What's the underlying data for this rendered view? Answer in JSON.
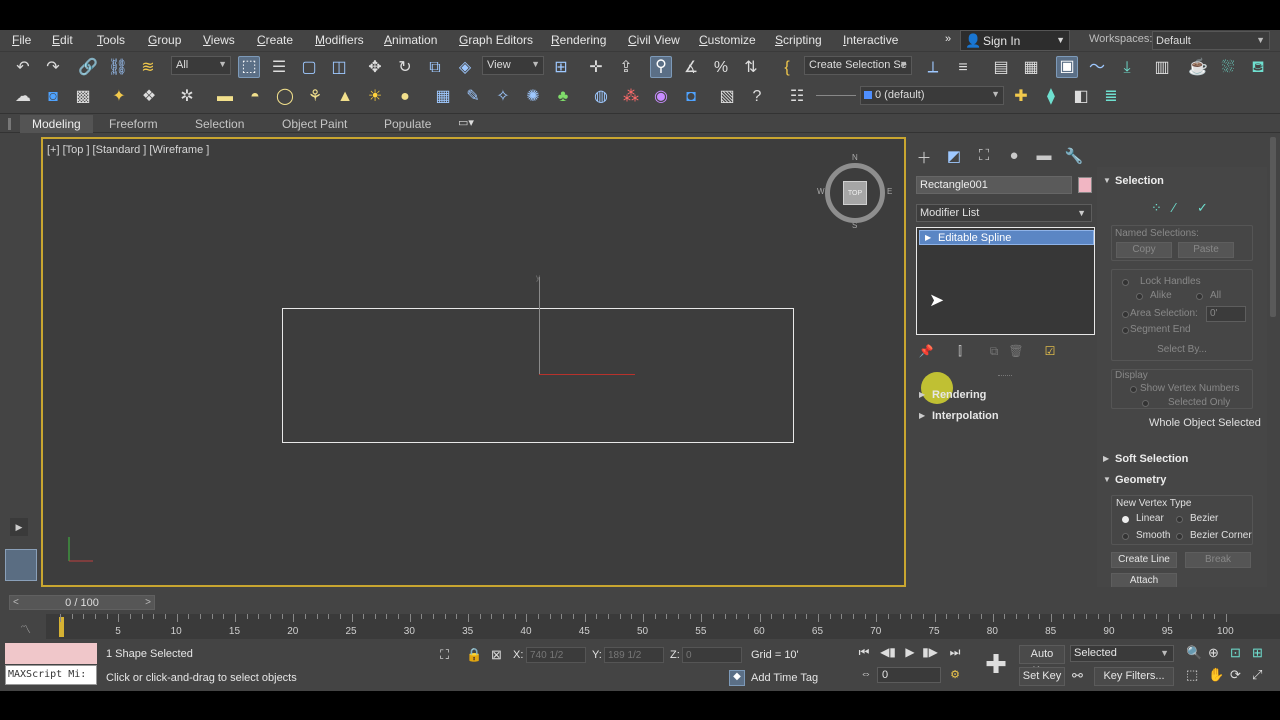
{
  "menubar": {
    "items": [
      {
        "label": "File",
        "key": "F"
      },
      {
        "label": "Edit",
        "key": "E"
      },
      {
        "label": "Tools",
        "key": "T"
      },
      {
        "label": "Group",
        "key": "G"
      },
      {
        "label": "Views",
        "key": "V"
      },
      {
        "label": "Create",
        "key": "C"
      },
      {
        "label": "Modifiers",
        "key": "M"
      },
      {
        "label": "Animation",
        "key": "A"
      },
      {
        "label": "Graph Editors",
        "key": "G"
      },
      {
        "label": "Rendering",
        "key": "R"
      },
      {
        "label": "Civil View",
        "key": "C"
      },
      {
        "label": "Customize",
        "key": "C"
      },
      {
        "label": "Scripting",
        "key": "S"
      },
      {
        "label": "Interactive",
        "key": "I"
      }
    ],
    "overflow": "»",
    "signin": "Sign In",
    "workspaces_label": "Workspaces:",
    "workspace_value": "Default"
  },
  "toolbar1": {
    "filter_value": "All",
    "refcoord_value": "View",
    "selection_set_value": "Create Selection Se"
  },
  "toolbar2": {
    "layer_value": "0 (default)"
  },
  "ribbon": {
    "tabs": [
      "Modeling",
      "Freeform",
      "Selection",
      "Object Paint",
      "Populate"
    ]
  },
  "viewport": {
    "label": "[+] [Top ] [Standard ] [Wireframe ]",
    "viewcube_face": "TOP",
    "dir_n": "N",
    "dir_s": "S",
    "dir_w": "W",
    "dir_e": "E",
    "gizmo_y": "y"
  },
  "command_panel": {
    "object_name": "Rectangle001",
    "object_color": "#f1b6c3",
    "modifier_list": "Modifier List",
    "stack_item": "Editable Spline",
    "rollouts": [
      "Rendering",
      "Interpolation"
    ]
  },
  "selection_panel": {
    "title": "Selection",
    "named_selections": "Named Selections:",
    "copy": "Copy",
    "paste": "Paste",
    "lock_handles": "Lock Handles",
    "alike": "Alike",
    "all": "All",
    "area_selection": "Area Selection:",
    "area_value": "0'",
    "segment_end": "Segment End",
    "select_by": "Select By...",
    "display": "Display",
    "show_vertex_numbers": "Show Vertex Numbers",
    "selected_only": "Selected Only",
    "whole_object": "Whole Object Selected",
    "soft_selection": "Soft Selection",
    "geometry": "Geometry",
    "new_vertex_type": "New Vertex Type",
    "linear": "Linear",
    "bezier": "Bezier",
    "smooth": "Smooth",
    "bezier_corner": "Bezier Corner",
    "create_line": "Create Line",
    "break": "Break",
    "attach": "Attach"
  },
  "timeline": {
    "slider_label": "0 / 100",
    "prev": "<",
    "next": ">",
    "ticks": [
      5,
      10,
      15,
      20,
      25,
      30,
      35,
      40,
      45,
      50,
      55,
      60,
      65,
      70,
      75,
      80,
      85,
      90,
      95,
      100
    ]
  },
  "statusbar": {
    "maxscript": "MAXScript Mi:",
    "selected": "1 Shape Selected",
    "prompt": "Click or click-and-drag to select objects",
    "x_label": "X:",
    "x_value": "740 1/2",
    "y_label": "Y:",
    "y_value": "189 1/2",
    "z_label": "Z:",
    "z_value": "0",
    "grid": "Grid = 10'",
    "add_time_tag": "Add Time Tag",
    "auto_key": "Auto Key",
    "set_key": "Set Key",
    "selected_mode": "Selected",
    "key_filters": "Key Filters...",
    "frame": "0"
  }
}
